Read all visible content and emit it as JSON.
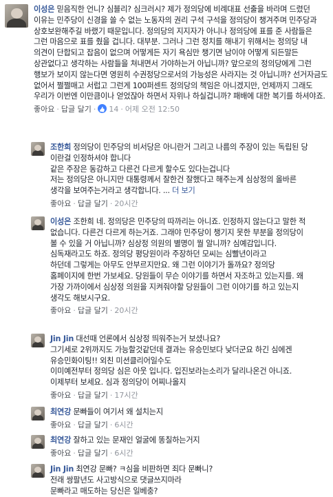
{
  "comments": [
    {
      "name": "이성은",
      "text": "믿음직한 언니? 심블리? 심크러시? 제가 정의당에 비례대표 선출을 바라며 드렸던 이유는 민주당이 신경을 쓸 수 없는 노동자의 권리 구석 구석을 정의당이 챙겨주며 민주당과 상호보완해주길 바랬기 때문입니다. 정의당의 지지자가 아니나 정의당에 표를 준 사람들은 그런 마음으로 표를 줬을 겁니다. 대부분. 그러나 그런 정치를 해내기 위해서는 정의당 내 의견이 단합되고 잡음이 없으며 어떻게든 자기 욕심만 챙기면 남이야 어떻게 되든말든 상관없다고 생각하는 사람들을 쳐내면서 가야하는거 아닙니까? 앞으로의 정의당에게 그런 행보가 보이지 않는다면 영원히 수권정당으로서의 가능성은 사라지는 것 아닙니까? 선거자금도 없어서 쩔쩔매고 서럽고 그런게 100퍼센트 정의당의 책임은 아니겠지만, 언제까지 그래도 우리가 이번엔 이만큼이나 얻었잖아 하면서 자위나 하실겁니까? 패배에 대한 복기를 하셔야죠.",
      "like": "좋아요",
      "reply": "답글 달기",
      "reactions": "14",
      "time": "어제 오전 12:50"
    },
    {
      "name": "조한희",
      "text": "정의당이 민주당의 비서당은 아니란거 그리고 나름의 주장이 있는 독립된 당 이란걸 인정하셔야 합니다\n같은 주장은 동감하고 다른건 다르게 할수도 있다는겁니다\n저는 정의당은 아니지만 대통령께서 잘한건 잘했다고 해주는게 심상정의 올바른 생각을 보여주는거라고 생각합니다. ...",
      "more": "더 보기",
      "like": "좋아요",
      "reply": "답글 달기",
      "time": "20시간"
    },
    {
      "name": "이성은",
      "text": "조한희 네. 정의당은 민주당의 따까리는 아니죠. 인정하지 않는다고 말한 적 없습니다. 다른건 다르게 하는거죠. 그래야 민주당이 챙기지 못한 부분을 정의당이 볼 수 있을 거 아닙니까? 심상정 의원의 별명이 뭘 알니까? 심예감입니다. 심독재라고도 하죠. 정의당 평당원이라 주장하던 모씨는 심빨년이라고\n하던데 그렇게는 아무도 안부르지만요. 왜 그런 이야기가 돌까요? 정의당 홈페이지에 한번 가보세요. 당원들이 무슨 이야기를 하면서 자조하고 있는지를. 왜 가장 가까이에서 심상정 의원을 지켜줘야할 당원들이 그런 이야기를 하고 있는지 생각도 해보시구요.",
      "like": "좋아요",
      "reply": "답글 달기",
      "time": "20시간"
    },
    {
      "name": "Jin Jin",
      "text": "대선때 언론에서 심상정 띄워주는거 보셨나요?\n그기세로 2위까지도 가능할것같던데 결과는 유승민보다 낮더군요 하긴 심에겐 유승민화이팅!! 외친 미션클리어일수도\n이미예전부터 정의당 심은 아웃 입니다. 입진보라는소리가 달리나온건 아니죠. 이제부터 보세요. 심과 정의당이 어찌나올지",
      "like": "좋아요",
      "reply": "답글 달기",
      "time": "17시간"
    },
    {
      "name": "최연강",
      "text": "문빠들이 여기서 왜 설치는지",
      "like": "좋아요",
      "reply": "답글 달기",
      "time": "6시간"
    },
    {
      "name": "최연강",
      "text": "잘하고 있는 문재인 얼굴에 똥칠하는거지",
      "like": "좋아요",
      "reply": "답글 달기",
      "time": "6시간"
    },
    {
      "name": "Jin Jin",
      "text": "최연강 문빠? ㅋ심을 비판하면 죄다 문빠니?\n전래 쌍팔년도 사고방식으로 댓글쓰지마라\n문빠라고 매도하는 당신은 일베충?",
      "like": "",
      "reply": "",
      "time": ""
    }
  ]
}
